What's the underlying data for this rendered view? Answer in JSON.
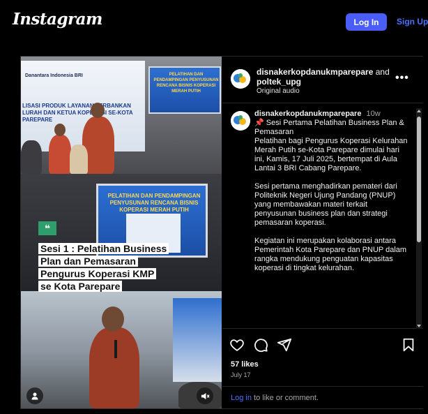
{
  "header": {
    "logo_text": "Instagram",
    "login_label": "Log In",
    "signup_label": "Sign Up"
  },
  "media": {
    "banner_brand": "Danantara Indonesia  BRI",
    "banner_text": "LISASI PRODUK LAYANAN PERBANKAN LURAH DAN KETUA KOPERASI SE-KOTA PAREPARE",
    "screen_top_text": "PELATIHAN DAN PENDAMPINGAN PENYUSUNAN RENCANA BISNIS KOPERASI MERAH PUTIH",
    "screen_mid_text": "PELATIHAN DAN PENDAMPINGAN PENYUSUNAN RENCANA BISNIS KOPERASI MERAH PUTIH",
    "quote_mark": "❝",
    "caption_lines": [
      "Sesi 1 : Pelatihan Business",
      "Plan dan Pemasaran",
      "Pengurus Koperasi KMP",
      "se Kota Parepare"
    ]
  },
  "post_header": {
    "author": "disnakerkopdanukmparepare",
    "and_text": "and",
    "collaborator": "poltek_upg",
    "audio": "Original audio",
    "more_label": "•••"
  },
  "caption": {
    "user": "disnakerkopdanukmparepare",
    "time": "10w",
    "paragraphs": [
      "📌 Sesi Pertama Pelatihan Business Plan & Pemasaran",
      "Pelatihan bagi Pengurus Koperasi Kelurahan Merah Putih se-Kota Parepare dimulai hari ini, Kamis, 17 Juli 2025, bertempat di Aula Lantai 3 BRI Cabang Parepare.",
      "",
      "Sesi pertama menghadirkan pemateri dari Politeknik Negeri Ujung Pandang (PNUP) yang membawakan materi terkait penyusunan business plan dan strategi pemasaran koperasi.",
      "",
      "Kegiatan ini merupakan kolaborasi antara Pemerintah Kota Parepare dan PNUP dalam rangka mendukung penguatan kapasitas koperasi di tingkat kelurahan."
    ]
  },
  "stats": {
    "likes": "57 likes",
    "date": "July 17"
  },
  "footer": {
    "login_link": "Log in",
    "rest_text": " to like or comment."
  }
}
